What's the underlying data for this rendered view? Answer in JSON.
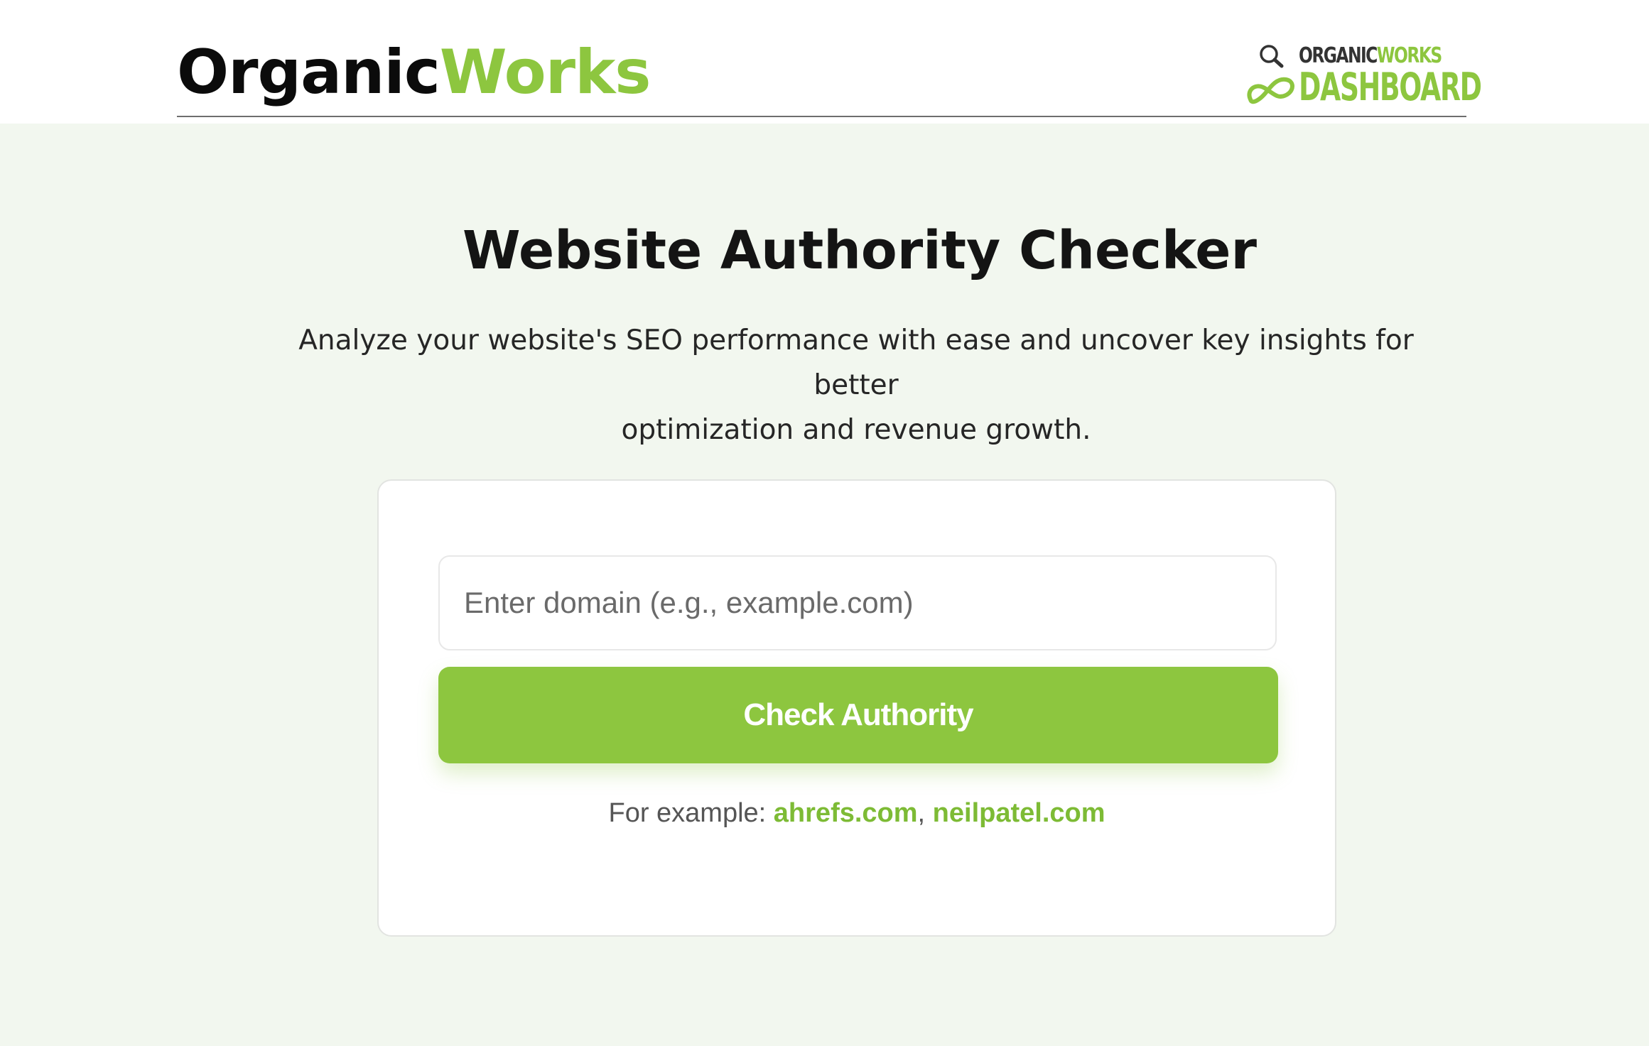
{
  "header": {
    "brand_part1": "Organic",
    "brand_part2": "Works",
    "dashboard_logo_line1_part1": "ORGANIC",
    "dashboard_logo_line1_part2": "WORKS",
    "dashboard_logo_line2": "DASHBOARD"
  },
  "main": {
    "title": "Website Authority Checker",
    "subtitle_line1": "Analyze your website's SEO performance with ease and  uncover key insights for better",
    "subtitle_line2": "optimization and revenue growth."
  },
  "form": {
    "input_value": "",
    "input_placeholder": "Enter domain (e.g., example.com)",
    "button_label": "Check Authority",
    "examples_prefix": "For example: ",
    "example_links": [
      "ahrefs.com",
      "neilpatel.com"
    ],
    "examples_separator": ", "
  },
  "colors": {
    "accent_green": "#8dc63f",
    "background": "#f2f7ef",
    "text_dark": "#141414"
  },
  "icons": [
    "magnifier-icon",
    "infinity-loop-icon"
  ]
}
